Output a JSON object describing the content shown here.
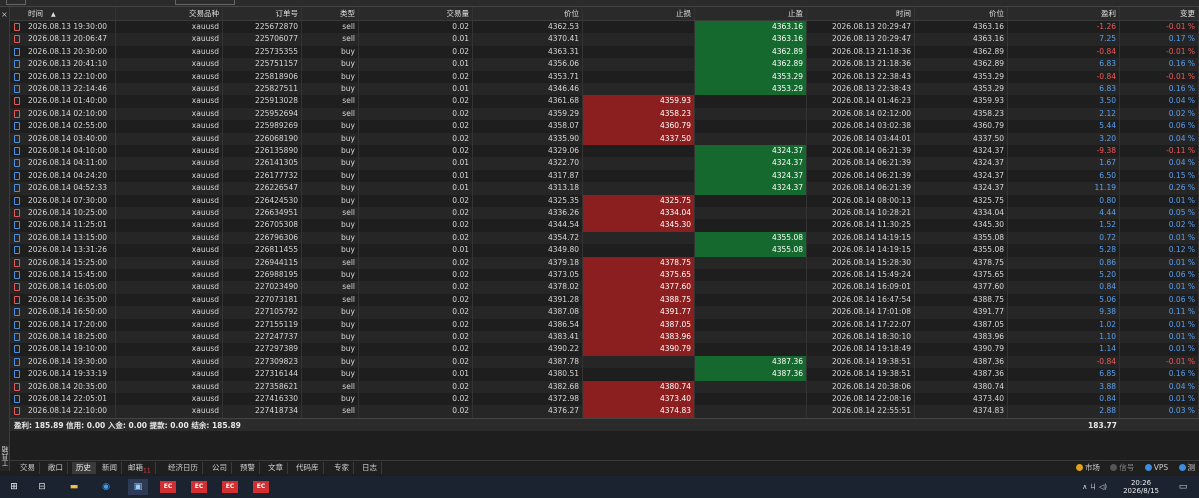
{
  "side_tab": "工具箱",
  "columns": [
    "时间",
    "交易品种",
    "订单号",
    "类型",
    "交易量",
    "价位",
    "止损",
    "止盈",
    "时间",
    "价位",
    "盈利",
    "变更"
  ],
  "sort_arrow": "▲",
  "rows": [
    {
      "time": "2026.08.13 19:30:00",
      "sym": "xauusd",
      "ord": "225672870",
      "type": "sell",
      "vol": "0.02",
      "price": "4362.53",
      "sl": "",
      "tp": "4363.16",
      "ctime": "2026.08.13 20:29:47",
      "cprice": "4363.16",
      "profit": "-1.26",
      "chg": "-0.01 %"
    },
    {
      "time": "2026.08.13 20:06:47",
      "sym": "xauusd",
      "ord": "225706077",
      "type": "sell",
      "vol": "0.01",
      "price": "4370.41",
      "sl": "",
      "tp": "4363.16",
      "ctime": "2026.08.13 20:29:47",
      "cprice": "4363.16",
      "profit": "7.25",
      "chg": "0.17 %"
    },
    {
      "time": "2026.08.13 20:30:00",
      "sym": "xauusd",
      "ord": "225735355",
      "type": "buy",
      "vol": "0.02",
      "price": "4363.31",
      "sl": "",
      "tp": "4362.89",
      "ctime": "2026.08.13 21:18:36",
      "cprice": "4362.89",
      "profit": "-0.84",
      "chg": "-0.01 %"
    },
    {
      "time": "2026.08.13 20:41:10",
      "sym": "xauusd",
      "ord": "225751157",
      "type": "buy",
      "vol": "0.01",
      "price": "4356.06",
      "sl": "",
      "tp": "4362.89",
      "ctime": "2026.08.13 21:18:36",
      "cprice": "4362.89",
      "profit": "6.83",
      "chg": "0.16 %"
    },
    {
      "time": "2026.08.13 22:10:00",
      "sym": "xauusd",
      "ord": "225818906",
      "type": "buy",
      "vol": "0.02",
      "price": "4353.71",
      "sl": "",
      "tp": "4353.29",
      "ctime": "2026.08.13 22:38:43",
      "cprice": "4353.29",
      "profit": "-0.84",
      "chg": "-0.01 %"
    },
    {
      "time": "2026.08.13 22:14:46",
      "sym": "xauusd",
      "ord": "225827511",
      "type": "buy",
      "vol": "0.01",
      "price": "4346.46",
      "sl": "",
      "tp": "4353.29",
      "ctime": "2026.08.13 22:38:43",
      "cprice": "4353.29",
      "profit": "6.83",
      "chg": "0.16 %"
    },
    {
      "time": "2026.08.14 01:40:00",
      "sym": "xauusd",
      "ord": "225913028",
      "type": "sell",
      "vol": "0.02",
      "price": "4361.68",
      "sl": "4359.93",
      "tp": "",
      "ctime": "2026.08.14 01:46:23",
      "cprice": "4359.93",
      "profit": "3.50",
      "chg": "0.04 %"
    },
    {
      "time": "2026.08.14 02:10:00",
      "sym": "xauusd",
      "ord": "225952694",
      "type": "sell",
      "vol": "0.02",
      "price": "4359.29",
      "sl": "4358.23",
      "tp": "",
      "ctime": "2026.08.14 02:12:00",
      "cprice": "4358.23",
      "profit": "2.12",
      "chg": "0.02 %"
    },
    {
      "time": "2026.08.14 02:55:00",
      "sym": "xauusd",
      "ord": "225989269",
      "type": "buy",
      "vol": "0.02",
      "price": "4358.07",
      "sl": "4360.79",
      "tp": "",
      "ctime": "2026.08.14 03:02:38",
      "cprice": "4360.79",
      "profit": "5.44",
      "chg": "0.06 %"
    },
    {
      "time": "2026.08.14 03:40:00",
      "sym": "xauusd",
      "ord": "226068190",
      "type": "buy",
      "vol": "0.02",
      "price": "4335.90",
      "sl": "4337.50",
      "tp": "",
      "ctime": "2026.08.14 03:44:01",
      "cprice": "4337.50",
      "profit": "3.20",
      "chg": "0.04 %"
    },
    {
      "time": "2026.08.14 04:10:00",
      "sym": "xauusd",
      "ord": "226135890",
      "type": "buy",
      "vol": "0.02",
      "price": "4329.06",
      "sl": "",
      "tp": "4324.37",
      "ctime": "2026.08.14 06:21:39",
      "cprice": "4324.37",
      "profit": "-9.38",
      "chg": "-0.11 %"
    },
    {
      "time": "2026.08.14 04:11:00",
      "sym": "xauusd",
      "ord": "226141305",
      "type": "buy",
      "vol": "0.01",
      "price": "4322.70",
      "sl": "",
      "tp": "4324.37",
      "ctime": "2026.08.14 06:21:39",
      "cprice": "4324.37",
      "profit": "1.67",
      "chg": "0.04 %"
    },
    {
      "time": "2026.08.14 04:24:20",
      "sym": "xauusd",
      "ord": "226177732",
      "type": "buy",
      "vol": "0.01",
      "price": "4317.87",
      "sl": "",
      "tp": "4324.37",
      "ctime": "2026.08.14 06:21:39",
      "cprice": "4324.37",
      "profit": "6.50",
      "chg": "0.15 %"
    },
    {
      "time": "2026.08.14 04:52:33",
      "sym": "xauusd",
      "ord": "226226547",
      "type": "buy",
      "vol": "0.01",
      "price": "4313.18",
      "sl": "",
      "tp": "4324.37",
      "ctime": "2026.08.14 06:21:39",
      "cprice": "4324.37",
      "profit": "11.19",
      "chg": "0.26 %"
    },
    {
      "time": "2026.08.14 07:30:00",
      "sym": "xauusd",
      "ord": "226424530",
      "type": "buy",
      "vol": "0.02",
      "price": "4325.35",
      "sl": "4325.75",
      "tp": "",
      "ctime": "2026.08.14 08:00:13",
      "cprice": "4325.75",
      "profit": "0.80",
      "chg": "0.01 %"
    },
    {
      "time": "2026.08.14 10:25:00",
      "sym": "xauusd",
      "ord": "226634951",
      "type": "sell",
      "vol": "0.02",
      "price": "4336.26",
      "sl": "4334.04",
      "tp": "",
      "ctime": "2026.08.14 10:28:21",
      "cprice": "4334.04",
      "profit": "4.44",
      "chg": "0.05 %"
    },
    {
      "time": "2026.08.14 11:25:01",
      "sym": "xauusd",
      "ord": "226705308",
      "type": "buy",
      "vol": "0.02",
      "price": "4344.54",
      "sl": "4345.30",
      "tp": "",
      "ctime": "2026.08.14 11:30:25",
      "cprice": "4345.30",
      "profit": "1.52",
      "chg": "0.02 %"
    },
    {
      "time": "2026.08.14 13:15:00",
      "sym": "xauusd",
      "ord": "226796306",
      "type": "buy",
      "vol": "0.02",
      "price": "4354.72",
      "sl": "",
      "tp": "4355.08",
      "ctime": "2026.08.14 14:19:15",
      "cprice": "4355.08",
      "profit": "0.72",
      "chg": "0.01 %"
    },
    {
      "time": "2026.08.14 13:31:26",
      "sym": "xauusd",
      "ord": "226811455",
      "type": "buy",
      "vol": "0.01",
      "price": "4349.80",
      "sl": "",
      "tp": "4355.08",
      "ctime": "2026.08.14 14:19:15",
      "cprice": "4355.08",
      "profit": "5.28",
      "chg": "0.12 %"
    },
    {
      "time": "2026.08.14 15:25:00",
      "sym": "xauusd",
      "ord": "226944115",
      "type": "sell",
      "vol": "0.02",
      "price": "4379.18",
      "sl": "4378.75",
      "tp": "",
      "ctime": "2026.08.14 15:28:30",
      "cprice": "4378.75",
      "profit": "0.86",
      "chg": "0.01 %"
    },
    {
      "time": "2026.08.14 15:45:00",
      "sym": "xauusd",
      "ord": "226988195",
      "type": "buy",
      "vol": "0.02",
      "price": "4373.05",
      "sl": "4375.65",
      "tp": "",
      "ctime": "2026.08.14 15:49:24",
      "cprice": "4375.65",
      "profit": "5.20",
      "chg": "0.06 %"
    },
    {
      "time": "2026.08.14 16:05:00",
      "sym": "xauusd",
      "ord": "227023490",
      "type": "sell",
      "vol": "0.02",
      "price": "4378.02",
      "sl": "4377.60",
      "tp": "",
      "ctime": "2026.08.14 16:09:01",
      "cprice": "4377.60",
      "profit": "0.84",
      "chg": "0.01 %"
    },
    {
      "time": "2026.08.14 16:35:00",
      "sym": "xauusd",
      "ord": "227073181",
      "type": "sell",
      "vol": "0.02",
      "price": "4391.28",
      "sl": "4388.75",
      "tp": "",
      "ctime": "2026.08.14 16:47:54",
      "cprice": "4388.75",
      "profit": "5.06",
      "chg": "0.06 %"
    },
    {
      "time": "2026.08.14 16:50:00",
      "sym": "xauusd",
      "ord": "227105792",
      "type": "buy",
      "vol": "0.02",
      "price": "4387.08",
      "sl": "4391.77",
      "tp": "",
      "ctime": "2026.08.14 17:01:08",
      "cprice": "4391.77",
      "profit": "9.38",
      "chg": "0.11 %"
    },
    {
      "time": "2026.08.14 17:20:00",
      "sym": "xauusd",
      "ord": "227155119",
      "type": "buy",
      "vol": "0.02",
      "price": "4386.54",
      "sl": "4387.05",
      "tp": "",
      "ctime": "2026.08.14 17:22:07",
      "cprice": "4387.05",
      "profit": "1.02",
      "chg": "0.01 %"
    },
    {
      "time": "2026.08.14 18:25:00",
      "sym": "xauusd",
      "ord": "227247737",
      "type": "buy",
      "vol": "0.02",
      "price": "4383.41",
      "sl": "4383.96",
      "tp": "",
      "ctime": "2026.08.14 18:30:10",
      "cprice": "4383.96",
      "profit": "1.10",
      "chg": "0.01 %"
    },
    {
      "time": "2026.08.14 19:10:00",
      "sym": "xauusd",
      "ord": "227297389",
      "type": "buy",
      "vol": "0.02",
      "price": "4390.22",
      "sl": "4390.79",
      "tp": "",
      "ctime": "2026.08.14 19:18:49",
      "cprice": "4390.79",
      "profit": "1.14",
      "chg": "0.01 %"
    },
    {
      "time": "2026.08.14 19:30:00",
      "sym": "xauusd",
      "ord": "227309823",
      "type": "buy",
      "vol": "0.02",
      "price": "4387.78",
      "sl": "",
      "tp": "4387.36",
      "ctime": "2026.08.14 19:38:51",
      "cprice": "4387.36",
      "profit": "-0.84",
      "chg": "-0.01 %"
    },
    {
      "time": "2026.08.14 19:33:19",
      "sym": "xauusd",
      "ord": "227316144",
      "type": "buy",
      "vol": "0.01",
      "price": "4380.51",
      "sl": "",
      "tp": "4387.36",
      "ctime": "2026.08.14 19:38:51",
      "cprice": "4387.36",
      "profit": "6.85",
      "chg": "0.16 %"
    },
    {
      "time": "2026.08.14 20:35:00",
      "sym": "xauusd",
      "ord": "227358621",
      "type": "sell",
      "vol": "0.02",
      "price": "4382.68",
      "sl": "4380.74",
      "tp": "",
      "ctime": "2026.08.14 20:38:06",
      "cprice": "4380.74",
      "profit": "3.88",
      "chg": "0.04 %"
    },
    {
      "time": "2026.08.14 22:05:01",
      "sym": "xauusd",
      "ord": "227416330",
      "type": "buy",
      "vol": "0.02",
      "price": "4372.98",
      "sl": "4373.40",
      "tp": "",
      "ctime": "2026.08.14 22:08:16",
      "cprice": "4373.40",
      "profit": "0.84",
      "chg": "0.01 %"
    },
    {
      "time": "2026.08.14 22:10:00",
      "sym": "xauusd",
      "ord": "227418734",
      "type": "sell",
      "vol": "0.02",
      "price": "4376.27",
      "sl": "4374.83",
      "tp": "",
      "ctime": "2026.08.14 22:55:51",
      "cprice": "4374.83",
      "profit": "2.88",
      "chg": "0.03 %"
    }
  ],
  "totals": {
    "label": "盈利: 185.89  信用: 0.00  入金: 0.00  提款: 0.00  结余: 185.89",
    "profit": "183.77"
  },
  "tabs": [
    {
      "label": "交易"
    },
    {
      "label": "敞口"
    },
    {
      "label": "历史",
      "active": true
    },
    {
      "label": "新闻"
    },
    {
      "label": "邮箱",
      "badge": "11"
    },
    {
      "label": "经济日历"
    },
    {
      "label": "公司"
    },
    {
      "label": "预警"
    },
    {
      "label": "文章"
    },
    {
      "label": "代码库"
    },
    {
      "label": "专家"
    },
    {
      "label": "日志"
    }
  ],
  "status_right": {
    "market": "市场",
    "signals": "信号",
    "vps": "VPS",
    "tester": "测"
  },
  "taskbar": {
    "ec_label": "EC",
    "time": "20:26",
    "date": "2026/8/15",
    "tray": "∧ ㄐ ◁)"
  },
  "colors": {
    "sl_bg": "#8b1e1e",
    "tp_bg": "#16692e",
    "positive": "#5aa0f0",
    "negative": "#f05a5a"
  }
}
